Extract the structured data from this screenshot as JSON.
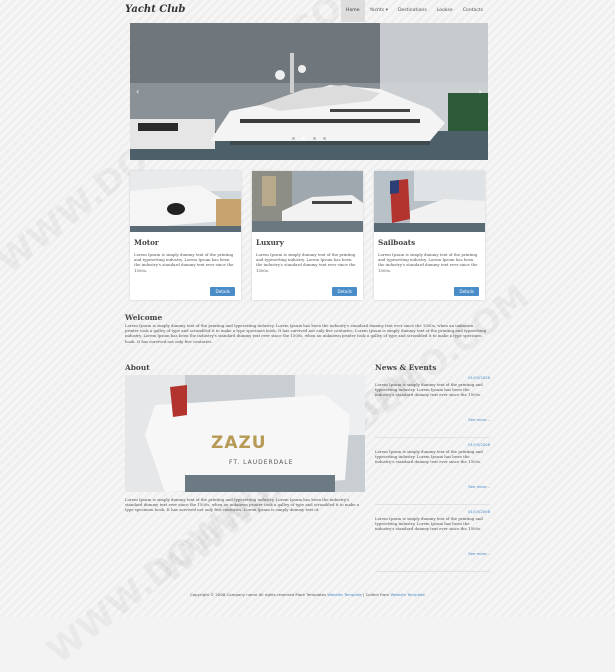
{
  "header": {
    "logo": "Yacht Club",
    "nav": [
      {
        "label": "Home",
        "active": true
      },
      {
        "label": "Yachts ▾",
        "active": false
      },
      {
        "label": "Destinations",
        "active": false
      },
      {
        "label": "Lookse",
        "active": false
      },
      {
        "label": "Contacts",
        "active": false
      }
    ]
  },
  "hero": {
    "prev": "‹",
    "next": "›",
    "slides": 4,
    "current": 2
  },
  "cards": [
    {
      "title": "Motor",
      "text": "Lorem Ipsum is simply dummy text of the printing and typesetting industry. Lorem Ipsum has been the industry's standard dummy text ever since the 1500s.",
      "button": "Details"
    },
    {
      "title": "Luxury",
      "text": "Lorem Ipsum is simply dummy text of the printing and typesetting industry. Lorem Ipsum has been the industry's standard dummy text ever since the 1500s.",
      "button": "Details"
    },
    {
      "title": "Sailboats",
      "text": "Lorem Ipsum is simply dummy text of the printing and typesetting industry. Lorem Ipsum has been the industry's standard dummy text ever since the 1500s.",
      "button": "Details"
    }
  ],
  "welcome": {
    "title": "Welcome",
    "text": "Lorem Ipsum is simply dummy text of the printing and typesetting industry. Lorem Ipsum has been the industry's standard dummy text ever since the 1500s, when an unknown printer took a galley of type and scrambled it to make a type specimen book. It has survived not only five centuries. Lorem Ipsum is simply dummy text of the printing and typesetting industry. Lorem Ipsum has been the industry's standard dummy text ever since the 1500s, when an unknown printer took a galley of type and scrambled it to make a type specimen book. It has survived not only five centuries."
  },
  "about": {
    "title": "About",
    "boat_name": "ZAZU",
    "boat_port": "FT. LAUDERDALE",
    "text": "Lorem Ipsum is simply dummy text of the printing and typesetting industry. Lorem Ipsum has been the industry's standard dummy text ever since the 1500s, when an unknown printer took a galley of type and scrambled it to make a type specimen book. It has survived not only five centuries. Lorem Ipsum is simply dummy text of."
  },
  "news": {
    "title": "News & Events",
    "items": [
      {
        "date": "01/03/2008",
        "text": "Lorem Ipsum is simply dummy text of the printing and typesetting industry. Lorem Ipsum has been the industry's standard dummy text ever since the 1500s.",
        "more": "See more..."
      },
      {
        "date": "01/03/2008",
        "text": "Lorem Ipsum is simply dummy text of the printing and typesetting industry. Lorem Ipsum has been the industry's standard dummy text ever since the 1500s.",
        "more": "See more..."
      },
      {
        "date": "01/03/2008",
        "text": "Lorem Ipsum is simply dummy text of the printing and typesetting industry. Lorem Ipsum has been the industry's standard dummy text ever since the 1500s.",
        "more": "See more..."
      }
    ]
  },
  "footer": {
    "copyright": "Copyright © 2008 Company name All rights reserved More Templates",
    "templates_link": "Website Template",
    "separator": "|",
    "collect_label": "Collect from",
    "collect_link": "Website Template"
  },
  "watermark": "WWW.DOWNDEMO.COM",
  "colors": {
    "accent": "#4a8cc7",
    "nav_active": "#dddddd"
  }
}
